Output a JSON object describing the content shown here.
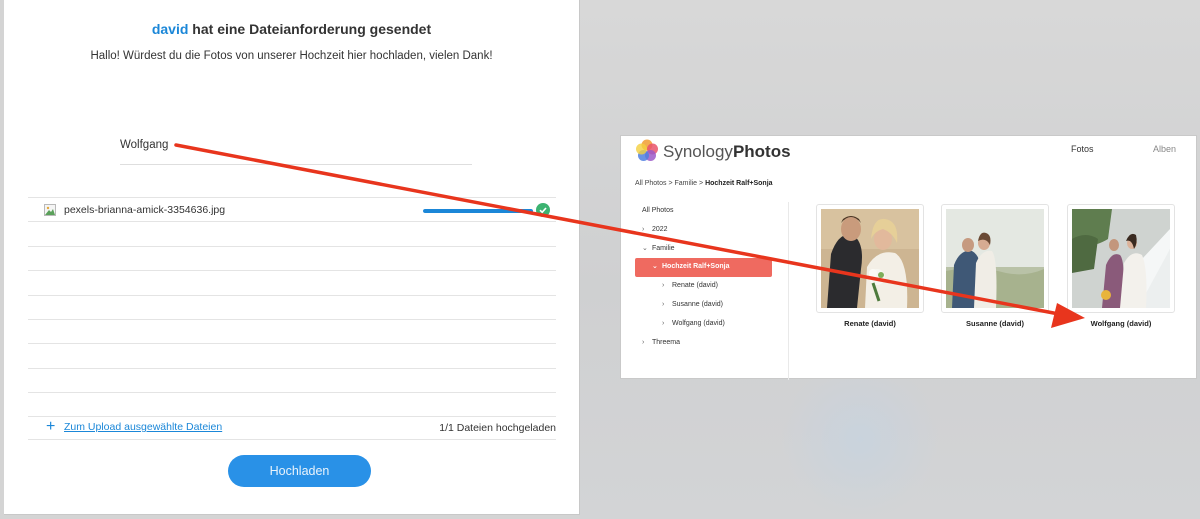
{
  "upload_page": {
    "title_user": "david",
    "title_rest": " hat eine Dateianforderung gesendet",
    "message": "Hallo! Würdest du die Fotos von unserer Hochzeit hier hochladen, vielen Dank!",
    "uploader_name": "Wolfgang",
    "files": [
      {
        "name": "pexels-brianna-amick-3354636.jpg",
        "progress_percent": 100,
        "status": "done"
      }
    ],
    "empty_row_count": 8,
    "add_files_label": "Zum Upload ausgewählte Dateien",
    "upload_count": "1/1 Dateien hochgeladen",
    "upload_button": "Hochladen",
    "accent_color": "#1b87d8",
    "success_color": "#3cb371"
  },
  "photos_app": {
    "brand_light": "Synology",
    "brand_bold": "Photos",
    "nav": {
      "fotos": "Fotos",
      "alben": "Alben"
    },
    "breadcrumb": {
      "part1": "All Photos",
      "sep1": " > ",
      "part2": "Familie",
      "sep2": " > ",
      "current": "Hochzeit Ralf+Sonja"
    },
    "tree": {
      "all_photos": "All Photos",
      "y2022": "2022",
      "familie": "Familie",
      "hochzeit": "Hochzeit Ralf+Sonja",
      "renate": "Renate (david)",
      "susanne": "Susanne (david)",
      "wolfgang": "Wolfgang (david)",
      "threema": "Threema"
    },
    "albums": [
      "Renate (david)",
      "Susanne (david)",
      "Wolfgang (david)"
    ],
    "selected_color": "#ef6a60"
  },
  "annotation": {
    "arrow_color": "#e8351d"
  }
}
